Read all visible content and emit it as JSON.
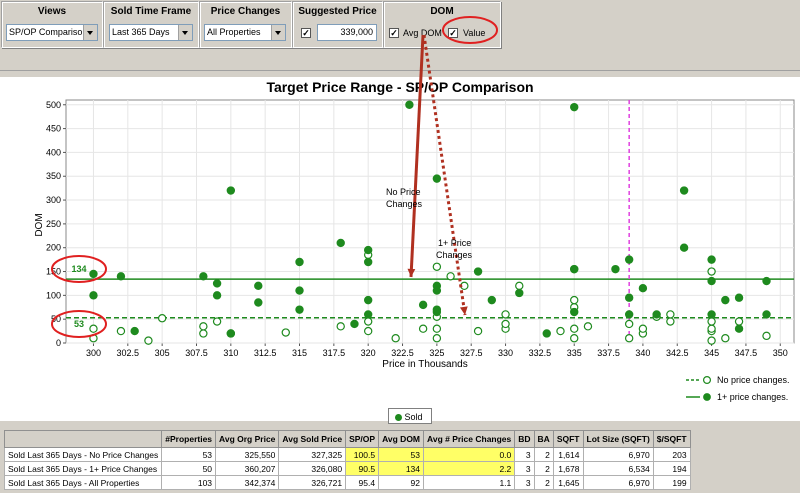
{
  "toolbar": {
    "views": {
      "title": "Views",
      "value": "SP/OP Comparison"
    },
    "timeframe": {
      "title": "Sold Time Frame",
      "value": "Last 365 Days"
    },
    "price_changes": {
      "title": "Price Changes",
      "value": "All Properties"
    },
    "suggested_price": {
      "title": "Suggested Price",
      "value": "339,000",
      "checked": true
    },
    "dom": {
      "title": "DOM",
      "avg_dom_label": "Avg DOM",
      "value_label": "Value",
      "avg_dom_checked": true,
      "value_checked": true
    }
  },
  "chart_data": {
    "type": "scatter",
    "title": "Target Price Range - SP/OP Comparison",
    "xlabel": "Price in Thousands",
    "ylabel": "DOM",
    "xlim": [
      298,
      351
    ],
    "ylim": [
      0,
      510
    ],
    "x_ticks": [
      "300",
      "302.5",
      "305",
      "307.5",
      "310",
      "312.5",
      "315",
      "317.5",
      "320",
      "322.5",
      "325",
      "327.5",
      "330",
      "332.5",
      "335",
      "337.5",
      "340",
      "342.5",
      "345",
      "347.5",
      "350"
    ],
    "y_ticks": [
      "0",
      "50",
      "100",
      "150",
      "200",
      "250",
      "300",
      "350",
      "400",
      "450",
      "500"
    ],
    "avg_dom_no_change": 53,
    "avg_dom_price_change": 134,
    "suggested_price_k": 339,
    "series": [
      {
        "name": "No price changes.",
        "style": "open",
        "color": "#1e8a1e",
        "points": [
          [
            300,
            10
          ],
          [
            300,
            30
          ],
          [
            302,
            25
          ],
          [
            304,
            5
          ],
          [
            305,
            52
          ],
          [
            308,
            20
          ],
          [
            308,
            35
          ],
          [
            309,
            45
          ],
          [
            310,
            20
          ],
          [
            314,
            22
          ],
          [
            318,
            35
          ],
          [
            320,
            25
          ],
          [
            320,
            45
          ],
          [
            320,
            185
          ],
          [
            322,
            10
          ],
          [
            324,
            30
          ],
          [
            325,
            10
          ],
          [
            325,
            30
          ],
          [
            325,
            55
          ],
          [
            325,
            160
          ],
          [
            326,
            140
          ],
          [
            327,
            120
          ],
          [
            328,
            25
          ],
          [
            330,
            30
          ],
          [
            330,
            40
          ],
          [
            330,
            60
          ],
          [
            331,
            120
          ],
          [
            334,
            25
          ],
          [
            335,
            10
          ],
          [
            335,
            30
          ],
          [
            335,
            75
          ],
          [
            335,
            90
          ],
          [
            335,
            155
          ],
          [
            336,
            35
          ],
          [
            339,
            10
          ],
          [
            339,
            40
          ],
          [
            340,
            20
          ],
          [
            340,
            30
          ],
          [
            341,
            55
          ],
          [
            342,
            45
          ],
          [
            342,
            60
          ],
          [
            345,
            5
          ],
          [
            345,
            25
          ],
          [
            345,
            30
          ],
          [
            345,
            45
          ],
          [
            345,
            150
          ],
          [
            346,
            10
          ],
          [
            347,
            45
          ],
          [
            349,
            15
          ]
        ]
      },
      {
        "name": "1+ price changes.",
        "style": "filled",
        "color": "#1e8a1e",
        "points": [
          [
            300,
            145
          ],
          [
            300,
            100
          ],
          [
            302,
            140
          ],
          [
            303,
            25
          ],
          [
            308,
            140
          ],
          [
            309,
            125
          ],
          [
            309,
            100
          ],
          [
            310,
            20
          ],
          [
            310,
            320
          ],
          [
            312,
            120
          ],
          [
            312,
            85
          ],
          [
            315,
            170
          ],
          [
            315,
            110
          ],
          [
            315,
            70
          ],
          [
            318,
            210
          ],
          [
            319,
            40
          ],
          [
            320,
            195
          ],
          [
            320,
            170
          ],
          [
            320,
            90
          ],
          [
            320,
            60
          ],
          [
            323,
            500
          ],
          [
            324,
            80
          ],
          [
            325,
            345
          ],
          [
            325,
            120
          ],
          [
            325,
            110
          ],
          [
            325,
            70
          ],
          [
            325,
            65
          ],
          [
            328,
            150
          ],
          [
            329,
            90
          ],
          [
            331,
            105
          ],
          [
            333,
            20
          ],
          [
            335,
            495
          ],
          [
            335,
            155
          ],
          [
            335,
            65
          ],
          [
            338,
            155
          ],
          [
            339,
            175
          ],
          [
            339,
            95
          ],
          [
            339,
            60
          ],
          [
            340,
            115
          ],
          [
            341,
            60
          ],
          [
            343,
            320
          ],
          [
            343,
            200
          ],
          [
            345,
            175
          ],
          [
            345,
            130
          ],
          [
            345,
            60
          ],
          [
            346,
            90
          ],
          [
            347,
            95
          ],
          [
            347,
            30
          ],
          [
            349,
            130
          ],
          [
            349,
            60
          ]
        ]
      }
    ],
    "annotations": [
      {
        "text_line1": "No Price",
        "text_line2": "Changes"
      },
      {
        "text_line1": "1+ Price",
        "text_line2": "Changes"
      }
    ],
    "legend": [
      {
        "label": "No price changes.",
        "style": "dashed-open"
      },
      {
        "label": "1+ price changes.",
        "style": "solid-filled"
      }
    ],
    "sold_legend": "Sold",
    "callout_labels": [
      "134",
      "53"
    ],
    "colors": {
      "series": "#1e8a1e",
      "suggested_price_line": "#e040e0",
      "arrow": "#b03020",
      "callout": "#e02020"
    }
  },
  "table": {
    "headers": [
      "",
      "#Properties",
      "Avg Org Price",
      "Avg Sold Price",
      "SP/OP",
      "Avg DOM",
      "Avg # Price Changes",
      "BD",
      "BA",
      "SQFT",
      "Lot Size (SQFT)",
      "$/SQFT"
    ],
    "rows": [
      [
        "Sold Last 365 Days - No Price Changes",
        "53",
        "325,550",
        "327,325",
        "100.5",
        "53",
        "0.0",
        "3",
        "2",
        "1,614",
        "6,970",
        "203"
      ],
      [
        "Sold Last 365 Days - 1+ Price Changes",
        "50",
        "360,207",
        "326,080",
        "90.5",
        "134",
        "2.2",
        "3",
        "2",
        "1,678",
        "6,534",
        "194"
      ],
      [
        "Sold Last 365 Days - All Properties",
        "103",
        "342,374",
        "326,721",
        "95.4",
        "92",
        "1.1",
        "3",
        "2",
        "1,645",
        "6,970",
        "199"
      ]
    ],
    "highlight_cols": [
      4,
      5,
      6
    ],
    "highlight_rows": [
      0,
      1
    ]
  }
}
